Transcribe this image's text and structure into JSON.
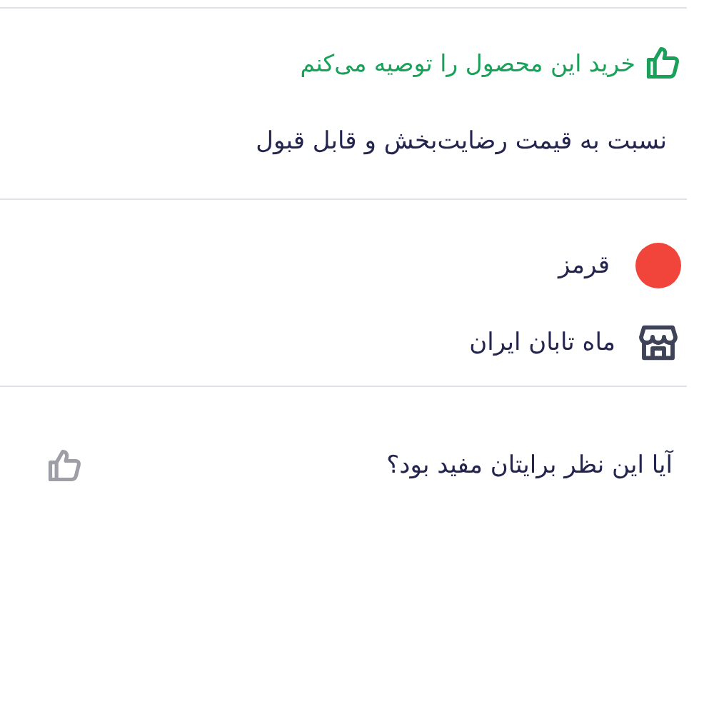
{
  "recommendation": {
    "text": "خرید این محصول را توصیه می‌کنم"
  },
  "comment": "نسبت به قیمت رضایت‌بخش و قابل قبول",
  "details": [
    {
      "kind": "color",
      "text": "قرمز",
      "color": "#f1453b"
    },
    {
      "kind": "seller",
      "text": "ماه تابان ایران"
    }
  ],
  "helpful": {
    "question": "آیا این نظر برایتان مفید بود؟"
  }
}
